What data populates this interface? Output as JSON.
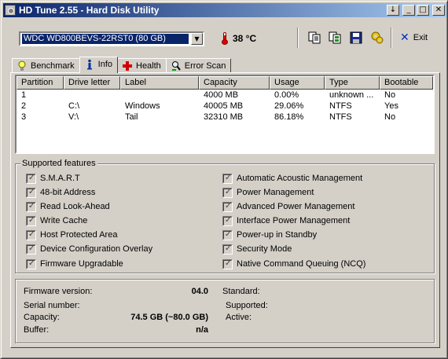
{
  "window": {
    "title": "HD Tune 2.55 - Hard Disk Utility"
  },
  "title_buttons": {
    "menu": "↓",
    "minimize": "_",
    "maximize": "□",
    "close": "✕"
  },
  "toolbar": {
    "drive": "WDC WD800BEVS-22RST0 (80 GB)",
    "temperature": "38 °C",
    "exit_label": "Exit"
  },
  "tabs": [
    {
      "label": "Benchmark",
      "icon": "lightbulb-icon"
    },
    {
      "label": "Info",
      "icon": "info-icon",
      "active": true
    },
    {
      "label": "Health",
      "icon": "cross-icon"
    },
    {
      "label": "Error Scan",
      "icon": "magnifier-icon"
    }
  ],
  "partitions": {
    "columns": [
      "Partition",
      "Drive letter",
      "Label",
      "Capacity",
      "Usage",
      "Type",
      "Bootable"
    ],
    "rows": [
      [
        "1",
        "",
        "",
        "4000 MB",
        "0.00%",
        "unknown ...",
        "No"
      ],
      [
        "2",
        "C:\\",
        "Windows",
        "40005 MB",
        "29.06%",
        "NTFS",
        "Yes"
      ],
      [
        "3",
        "V:\\",
        "Tail",
        "32310 MB",
        "86.18%",
        "NTFS",
        "No"
      ]
    ]
  },
  "features": {
    "title": "Supported features",
    "left": [
      "S.M.A.R.T",
      "48-bit Address",
      "Read Look-Ahead",
      "Write Cache",
      "Host Protected Area",
      "Device Configuration Overlay",
      "Firmware Upgradable"
    ],
    "right": [
      "Automatic Acoustic Management",
      "Power Management",
      "Advanced Power Management",
      "Interface Power Management",
      "Power-up in Standby",
      "Security Mode",
      "Native Command Queuing (NCQ)"
    ],
    "checkmark": "✓"
  },
  "info": {
    "firmware_label": "Firmware version:",
    "firmware_value": "04.0",
    "serial_label": "Serial number:",
    "serial_value": "",
    "capacity_label": "Capacity:",
    "capacity_value": "74.5 GB (~80.0 GB)",
    "buffer_label": "Buffer:",
    "buffer_value": "n/a",
    "standard_label": "Standard:",
    "supported_label": "Supported:",
    "active_label": "Active:"
  }
}
